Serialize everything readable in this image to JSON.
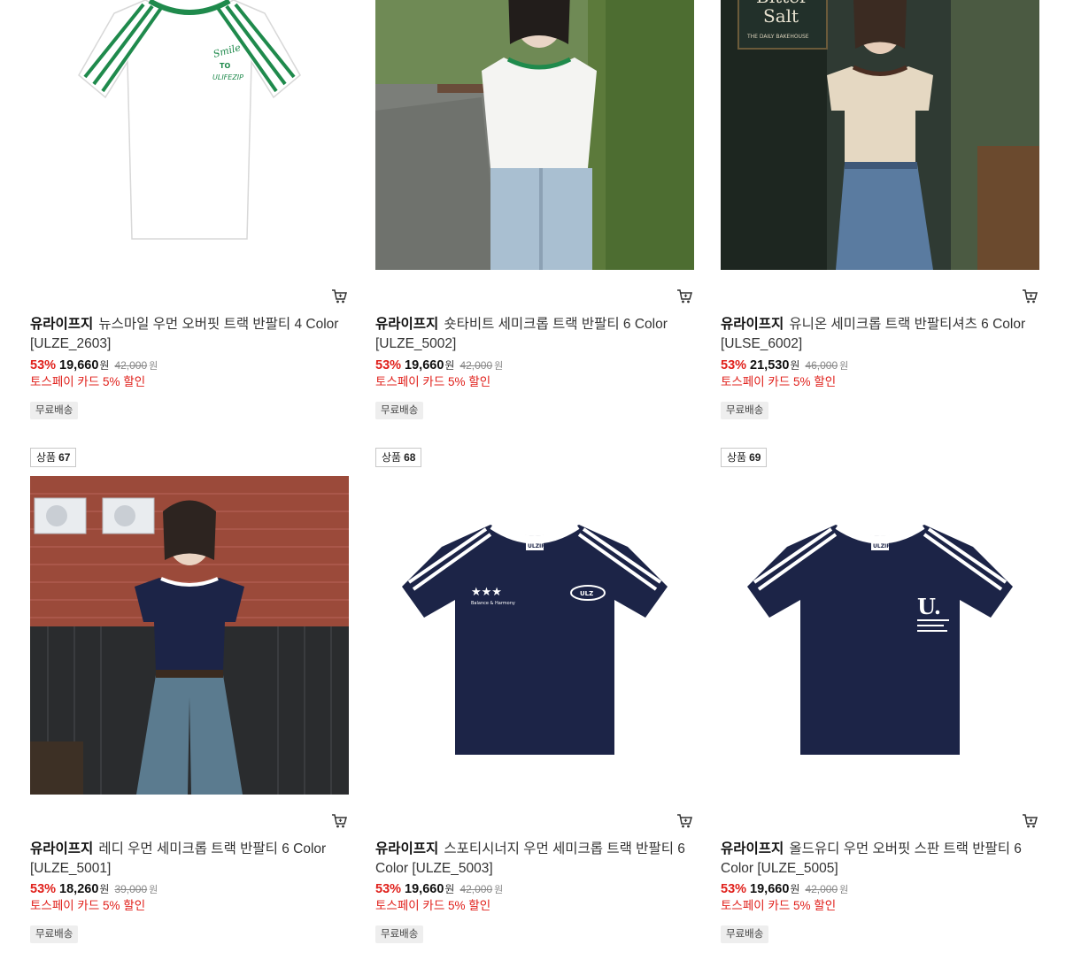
{
  "products": [
    {
      "rank_label": "",
      "rank_num": "",
      "brand": "유라이프지",
      "name": "뉴스마일 우먼 오버핏 트랙 반팔티 4 Color [ULZE_2603]",
      "discount": "53%",
      "price": "19,660",
      "currency": "원",
      "original_price": "42,000",
      "original_currency": "원",
      "promo": "토스페이 카드 5% 할인",
      "tag": "무료배송",
      "cart_icon": "cart-icon"
    },
    {
      "rank_label": "",
      "rank_num": "",
      "brand": "유라이프지",
      "name": "숏타비트 세미크롭 트랙 반팔티 6 Color [ULZE_5002]",
      "discount": "53%",
      "price": "19,660",
      "currency": "원",
      "original_price": "42,000",
      "original_currency": "원",
      "promo": "토스페이 카드 5% 할인",
      "tag": "무료배송",
      "cart_icon": "cart-icon"
    },
    {
      "rank_label": "",
      "rank_num": "",
      "brand": "유라이프지",
      "name": "유니온 세미크롭 트랙 반팔티셔츠 6 Color [ULSE_6002]",
      "discount": "53%",
      "price": "21,530",
      "currency": "원",
      "original_price": "46,000",
      "original_currency": "원",
      "promo": "토스페이 카드 5% 할인",
      "tag": "무료배송",
      "cart_icon": "cart-icon"
    },
    {
      "rank_label": "상품",
      "rank_num": "67",
      "brand": "유라이프지",
      "name": "레디 우먼 세미크롭 트랙 반팔티 6 Color [ULZE_5001]",
      "discount": "53%",
      "price": "18,260",
      "currency": "원",
      "original_price": "39,000",
      "original_currency": "원",
      "promo": "토스페이 카드 5% 할인",
      "tag": "무료배송",
      "cart_icon": "cart-icon"
    },
    {
      "rank_label": "상품",
      "rank_num": "68",
      "brand": "유라이프지",
      "name": "스포티시너지 우먼 세미크롭 트랙 반팔티 6 Color [ULZE_5003]",
      "discount": "53%",
      "price": "19,660",
      "currency": "원",
      "original_price": "42,000",
      "original_currency": "원",
      "promo": "토스페이 카드 5% 할인",
      "tag": "무료배송",
      "cart_icon": "cart-icon"
    },
    {
      "rank_label": "상품",
      "rank_num": "69",
      "brand": "유라이프지",
      "name": "올드유디 우먼 오버핏 스판 트랙 반팔티 6 Color [ULZE_5005]",
      "discount": "53%",
      "price": "19,660",
      "currency": "원",
      "original_price": "42,000",
      "original_currency": "원",
      "promo": "토스페이 카드 5% 할인",
      "tag": "무료배송",
      "cart_icon": "cart-icon"
    }
  ],
  "image_text": {
    "smile_logo": "Smile",
    "to_logo": "TO",
    "ulifezip_logo": "ULIFEZIP",
    "bakery_sign_1": "Bitter",
    "bakery_sign_2": "Salt",
    "bakery_sub": "THE DAILY BAKEHOUSE",
    "neck_label": "ULZIP",
    "ulz_oval": "ULZ",
    "balance_text": "Balance & Harmony",
    "big_u": "U."
  },
  "colors": {
    "discount_red": "#e0201b",
    "navy": "#1c2447",
    "green_stripe": "#1f8a4c",
    "tag_bg": "#eeeeee"
  }
}
